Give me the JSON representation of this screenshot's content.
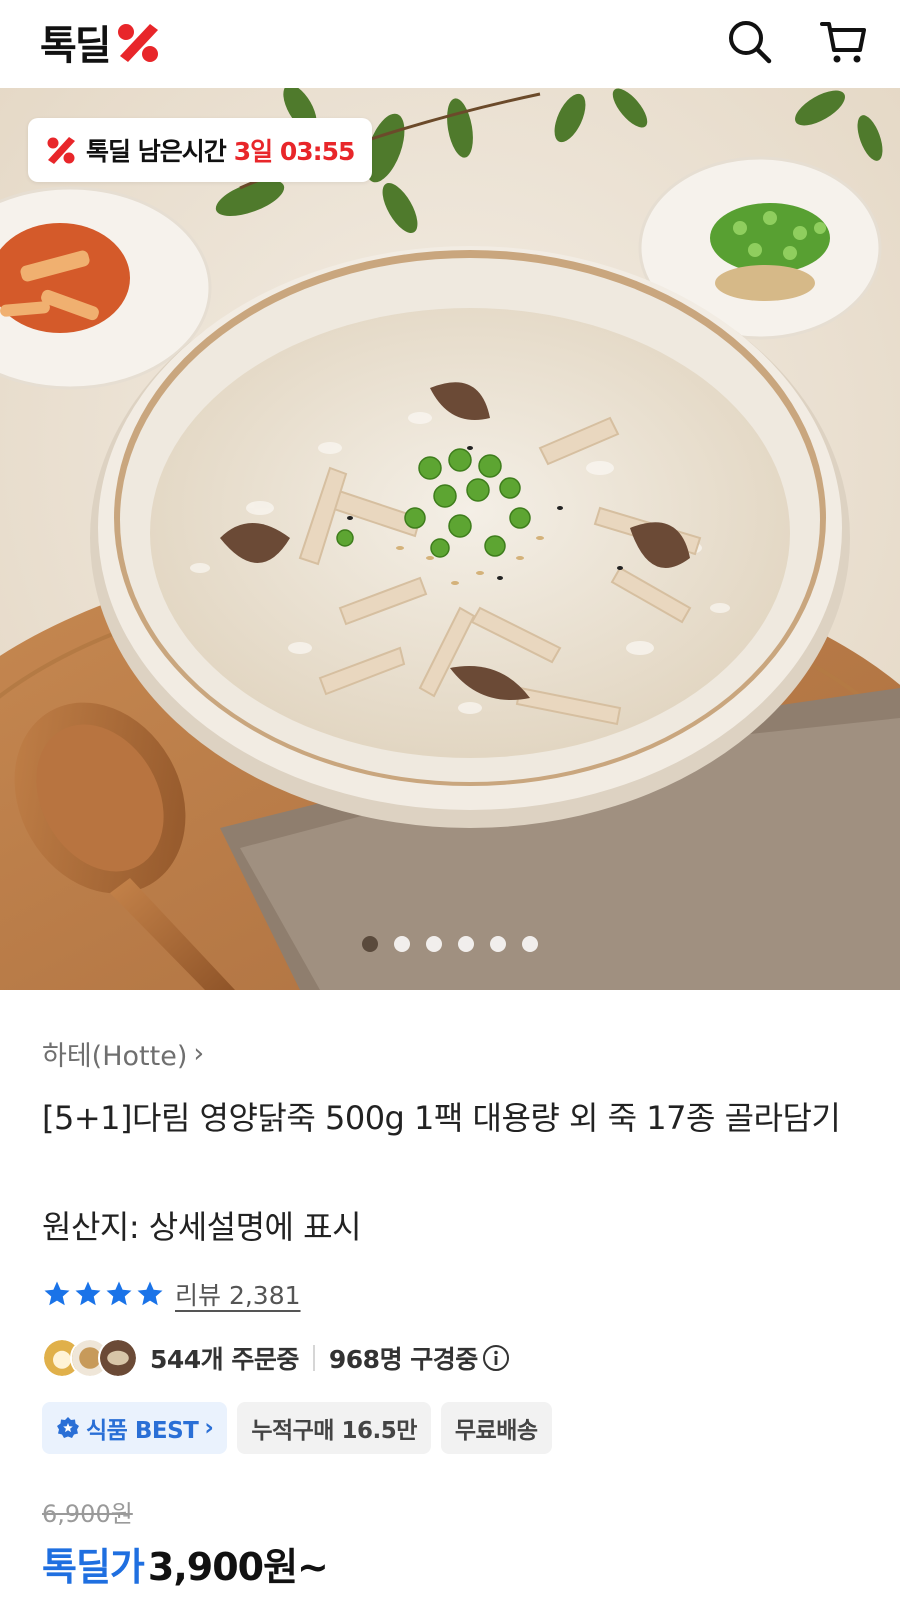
{
  "header": {
    "logo_text": "톡딜",
    "search_icon": "search-icon",
    "cart_icon": "cart-icon"
  },
  "hero": {
    "timer_label": "톡딜 남은시간",
    "timer_value": "3일 03:55",
    "slide_count": 6,
    "active_slide": 1
  },
  "product": {
    "brand": "하테(Hotte)",
    "brand_chevron": "›",
    "title": "[5+1]다림 영양닭죽 500g 1팩 대용량 외 죽 17종 골라담기",
    "origin": "원산지: 상세설명에 표시",
    "rating_stars": 4,
    "review_label": "리뷰 2,381",
    "orders": "544개 주문중",
    "viewers": "968명 구경중",
    "chips": {
      "best": "식품 BEST",
      "best_chevron": "›",
      "cumulative": "누적구매 16.5만",
      "shipping": "무료배송"
    },
    "original_price": "6,900원",
    "price_label": "톡딜가",
    "price_value": "3,900원~"
  },
  "colors": {
    "brand_red": "#e8262a",
    "price_blue": "#1f6fe0",
    "star_blue": "#1a73e8"
  }
}
